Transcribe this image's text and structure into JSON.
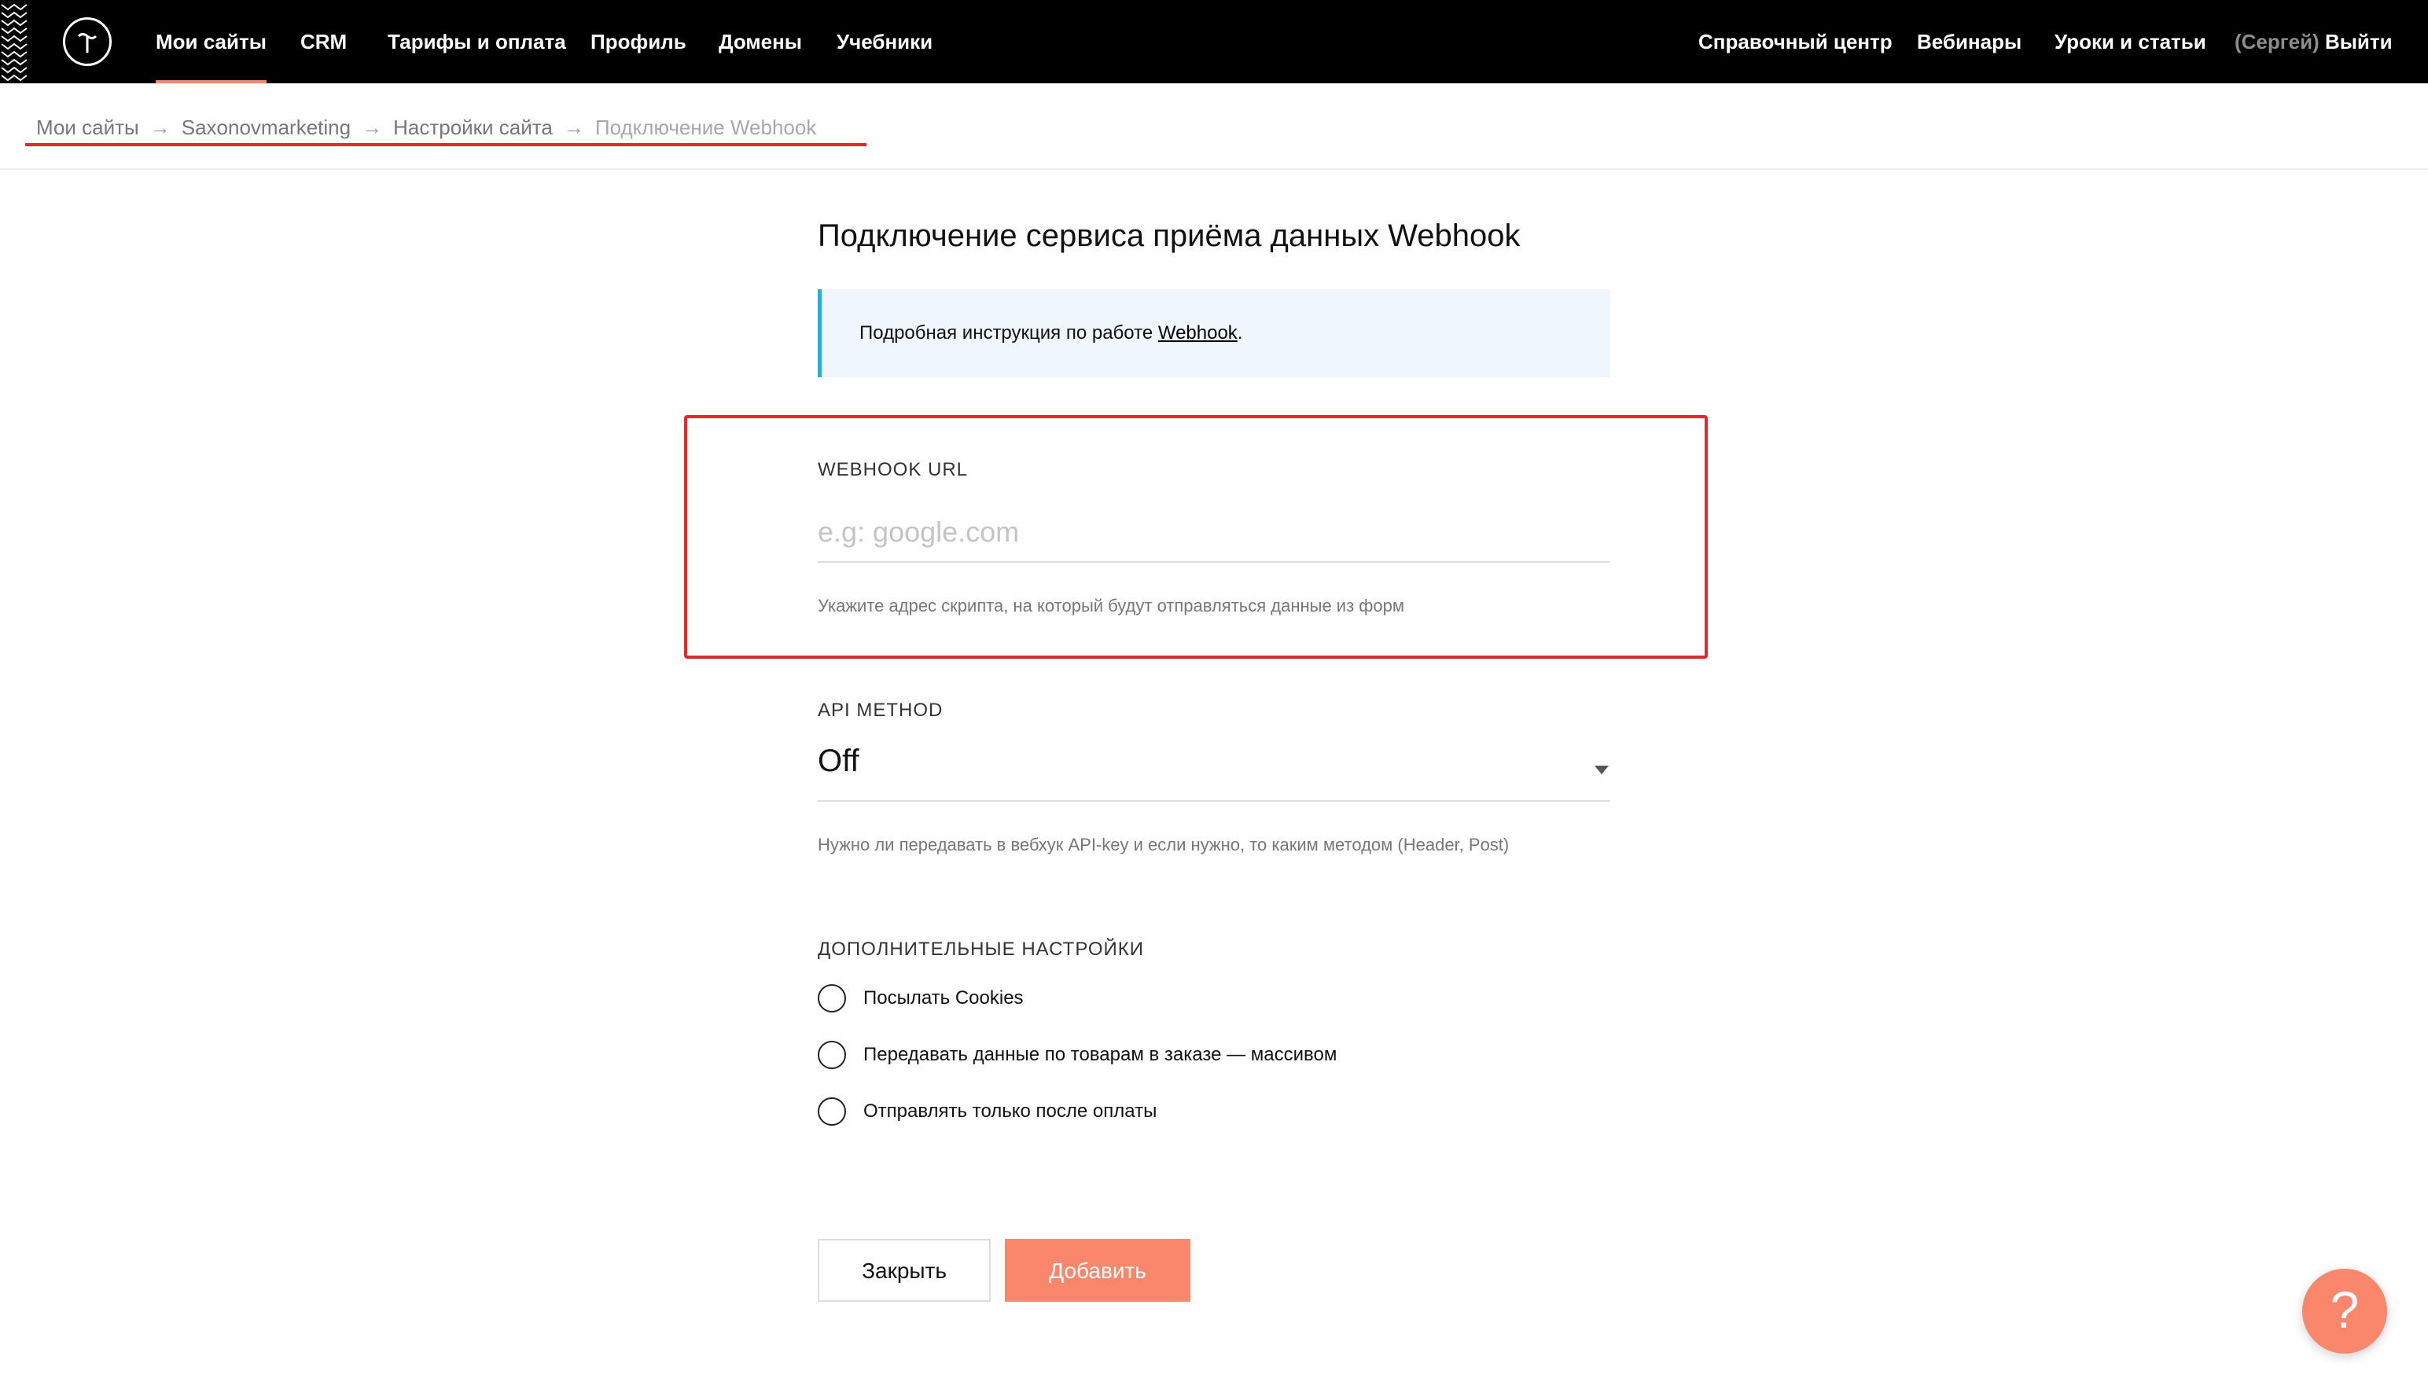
{
  "nav": {
    "left_items": [
      {
        "label": "Мои сайты",
        "active": true
      },
      {
        "label": "CRM"
      },
      {
        "label": "Тарифы и оплата"
      },
      {
        "label": "Профиль"
      },
      {
        "label": "Домены"
      },
      {
        "label": "Учебники"
      }
    ],
    "right_items": [
      {
        "label": "Справочный центр"
      },
      {
        "label": "Вебинары"
      },
      {
        "label": "Уроки и статьи"
      }
    ],
    "user_name": "(Сергей)",
    "logout_label": "Выйти",
    "accent_color": "#fa876b"
  },
  "breadcrumb": {
    "items": [
      "Мои сайты",
      "Saxonovmarketing",
      "Настройки сайта",
      "Подключение Webhook"
    ],
    "separator": "→"
  },
  "main": {
    "title": "Подключение сервиса приёма данных Webhook",
    "info": {
      "text": "Подробная инструкция по работе ",
      "link_label": "Webhook",
      "suffix": "."
    },
    "webhook_url": {
      "label": "WEBHOOK URL",
      "value": "",
      "placeholder": "e.g: google.com",
      "hint": "Укажите адрес скрипта, на который будут отправляться данные из форм"
    },
    "api_method": {
      "label": "API METHOD",
      "selected": "Off",
      "hint": "Нужно ли передавать в вебхук API-key и если нужно, то каким методом (Header, Post)"
    },
    "extra_settings": {
      "label": "ДОПОЛНИТЕЛЬНЫЕ НАСТРОЙКИ",
      "options": [
        {
          "label": "Посылать Cookies",
          "checked": false
        },
        {
          "label": "Передавать данные по товарам в заказе — массивом",
          "checked": false
        },
        {
          "label": "Отправлять только после оплаты",
          "checked": false
        }
      ]
    },
    "buttons": {
      "close_label": "Закрыть",
      "add_label": "Добавить"
    }
  },
  "help": {
    "label": "?"
  },
  "colors": {
    "highlight": "#e8272c",
    "info_border": "#1fb3d6",
    "info_bg": "#f0f6fd"
  }
}
